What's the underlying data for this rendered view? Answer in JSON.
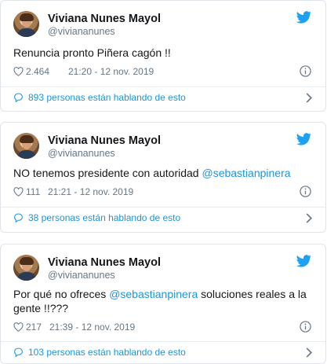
{
  "colors": {
    "accent": "#1b95e0",
    "muted": "#657786",
    "border": "#dfe5ea"
  },
  "icons": {
    "bird": "twitter-bird-icon",
    "heart": "heart-icon",
    "info": "info-icon",
    "bubble": "chat-bubble-icon",
    "chevron": "chevron-right-icon"
  },
  "tweets": [
    {
      "author": {
        "name": "Viviana Nunes Mayol",
        "handle": "@viviananunes"
      },
      "text_before": "Renuncia pronto Piñera cagón !!",
      "mention": "",
      "text_after": "",
      "likes": "2.464",
      "time": "21:20 - 12 nov. 2019",
      "talking": "893 personas están hablando de esto"
    },
    {
      "author": {
        "name": "Viviana Nunes Mayol",
        "handle": "@viviananunes"
      },
      "text_before": "NO tenemos presidente con autoridad ",
      "mention": "@sebastianpinera",
      "text_after": "",
      "likes": "111",
      "time": "21:21 - 12 nov. 2019",
      "talking": "38 personas están hablando de esto"
    },
    {
      "author": {
        "name": "Viviana Nunes Mayol",
        "handle": "@viviananunes"
      },
      "text_before": "Por qué no ofreces ",
      "mention": "@sebastianpinera",
      "text_after": " soluciones reales a la gente !!???",
      "likes": "217",
      "time": "21:39 - 12 nov. 2019",
      "talking": "103 personas están hablando de esto"
    }
  ]
}
